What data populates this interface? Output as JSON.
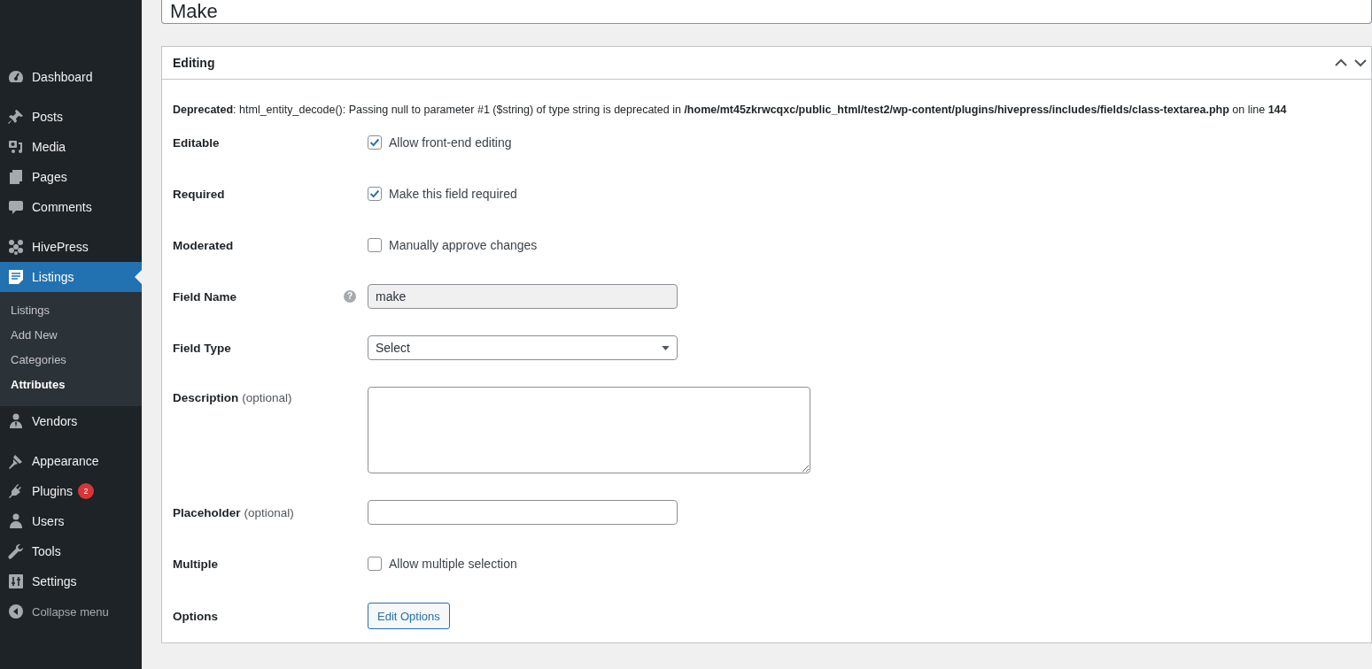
{
  "sidebar": {
    "groups": [
      [
        {
          "label": "Dashboard",
          "selected": false
        }
      ],
      [
        {
          "label": "Posts",
          "selected": false
        },
        {
          "label": "Media",
          "selected": false
        },
        {
          "label": "Pages",
          "selected": false
        },
        {
          "label": "Comments",
          "selected": false
        }
      ],
      [
        {
          "label": "HivePress",
          "selected": false
        },
        {
          "label": "Listings",
          "selected": true,
          "submenu": [
            {
              "label": "Listings",
              "selected": false
            },
            {
              "label": "Add New",
              "selected": false
            },
            {
              "label": "Categories",
              "selected": false
            },
            {
              "label": "Attributes",
              "selected": true
            }
          ]
        },
        {
          "label": "Vendors",
          "selected": false
        }
      ],
      [
        {
          "label": "Appearance",
          "selected": false
        },
        {
          "label": "Plugins",
          "selected": false,
          "badge": "2"
        },
        {
          "label": "Users",
          "selected": false
        },
        {
          "label": "Tools",
          "selected": false
        },
        {
          "label": "Settings",
          "selected": false
        }
      ]
    ],
    "collapse": "Collapse menu"
  },
  "title_field": {
    "value": "Make"
  },
  "panel": {
    "title": "Editing",
    "notice": "**Deprecated**: html_entity_decode(): Passing null to parameter #1 ($string) of type string is deprecated in **/home/mt45zkrwcqxc/public_html/test2/wp-content/plugins/hivepress/includes/fields/class-textarea.php** on line **144**",
    "rows": [
      {
        "kind": "checkbox",
        "label": "Editable",
        "option": "Allow front-end editing",
        "checked": true
      },
      {
        "kind": "checkbox",
        "label": "Required",
        "option": "Make this field required",
        "checked": true
      },
      {
        "kind": "checkbox",
        "label": "Moderated",
        "option": "Manually approve changes",
        "checked": false
      },
      {
        "kind": "text",
        "label": "Field Name",
        "value": "make",
        "disabled": true,
        "help": "?"
      },
      {
        "kind": "select",
        "label": "Field Type",
        "value": "Select"
      },
      {
        "kind": "textarea",
        "label": "Description",
        "note": "(optional)"
      },
      {
        "kind": "text",
        "label": "Placeholder",
        "note": "(optional)",
        "disabled": false
      },
      {
        "kind": "checkbox",
        "label": "Multiple",
        "option": "Allow multiple selection",
        "checked": false
      },
      {
        "kind": "button",
        "label": "Options",
        "button": "Edit Options"
      }
    ]
  }
}
